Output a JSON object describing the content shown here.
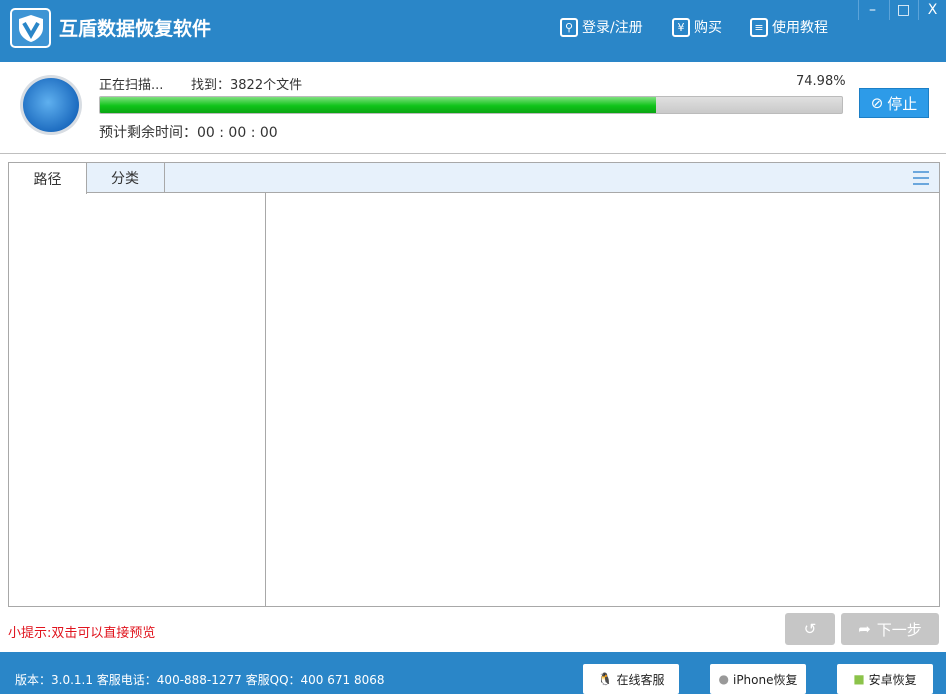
{
  "header": {
    "title": "互盾数据恢复软件",
    "login": "登录/注册",
    "buy": "购买",
    "tutorial": "使用教程",
    "yen": "¥",
    "minimize": "–",
    "maximize": "□",
    "close": "X"
  },
  "scan": {
    "status": "正在扫描...",
    "found": "找到：3822个文件",
    "percent_label": "74.98%",
    "progress": 74.98,
    "eta": "预计剩余时间：00 : 00 : 00",
    "stop": "停止"
  },
  "tabs": [
    {
      "label": "路径"
    },
    {
      "label": "分类"
    }
  ],
  "tip": "小提示:双击可以直接预览",
  "nav": {
    "next": "下一步"
  },
  "footer": {
    "info": "版本：3.0.1.1 客服电话：400-888-1277    客服QQ：400 671 8068",
    "online": "在线客服",
    "iphone": "iPhone恢复",
    "android": "安卓恢复"
  }
}
